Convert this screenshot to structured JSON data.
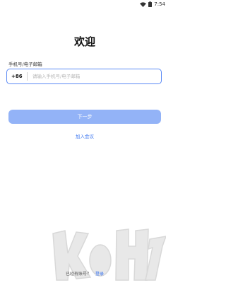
{
  "status_bar": {
    "time": "7:54"
  },
  "page": {
    "title": "欢迎"
  },
  "form": {
    "label": "手机号/电子邮箱",
    "country_code": "+86",
    "placeholder": "请输入手机号/电子邮箱",
    "value": ""
  },
  "actions": {
    "next_label": "下一步",
    "join_meeting_label": "加入会议"
  },
  "footer": {
    "prompt": "已经有账号？",
    "login_label": "登录"
  },
  "watermark": {
    "text": "k73",
    "shape": "site-logo-watermark"
  },
  "icons": [
    "wifi-icon",
    "battery-icon"
  ],
  "colors": {
    "accent": "#3c76f0",
    "button_disabled": "#93b3f7",
    "field_border": "#5b8af5"
  }
}
